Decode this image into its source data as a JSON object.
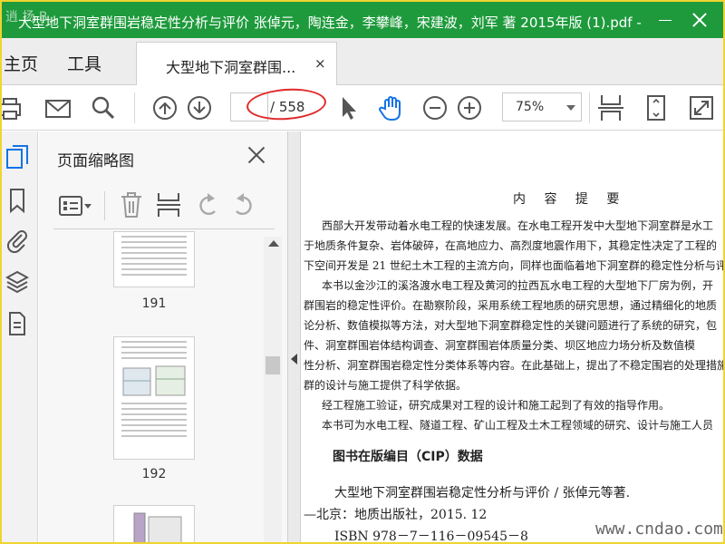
{
  "window": {
    "title": "大型地下洞室群围岩稳定性分析与评价 张倬元，陶连金，李攀峰，宋建波，刘军 著 2015年版 (1).pdf - Ad...",
    "watermark": "逍 扬 B"
  },
  "tabs": {
    "home": "主页",
    "tools": "工具",
    "document": "大型地下洞室群围...",
    "document_close": "×"
  },
  "toolbar": {
    "page_current": "",
    "page_total": "/ 558",
    "zoom": "75%"
  },
  "panel": {
    "title": "页面缩略图",
    "thumbnails": [
      {
        "page": "191"
      },
      {
        "page": "192"
      }
    ]
  },
  "document": {
    "heading": "内 容 提 要",
    "paragraphs": [
      "西部大开发带动着水电工程的快速发展。在水电工程开发中大型地下洞室群是水工",
      "于地质条件复杂、岩体破碎，在高地应力、高烈度地震作用下，其稳定性决定了工程的",
      "下空间开发是 21 世纪土木工程的主流方向，同样也面临着地下洞室群的稳定性分析与评",
      "本书以金沙江的溪洛渡水电工程及黄河的拉西瓦水电工程的大型地下厂房为例，开",
      "群围岩的稳定性评价。在勘察阶段，采用系统工程地质的研究思想，通过精细化的地质",
      "论分析、数值模拟等方法，对大型地下洞室群稳定性的关键问题进行了系统的研究，包",
      "件、洞室群围岩体结构调查、洞室群围岩体质量分类、坝区地应力场分析及数值模",
      "性分析、洞室群围岩稳定性分类体系等内容。在此基础上，提出了不稳定围岩的处理措施",
      "群的设计与施工提供了科学依据。",
      "经工程施工验证，研究成果对工程的设计和施工起到了有效的指导作用。",
      "本书可为水电工程、隧道工程、矿山工程及土木工程领域的研究、设计与施工人员"
    ],
    "cip_title": "图书在版编目（CIP）数据",
    "cip_lines": [
      "大型地下洞室群围岩稳定性分析与评价 / 张倬元等著.",
      "—北京：地质出版社，2015. 12",
      "ISBN 978－7－116－09545－8"
    ],
    "site_watermark": "www.cndao.com"
  }
}
